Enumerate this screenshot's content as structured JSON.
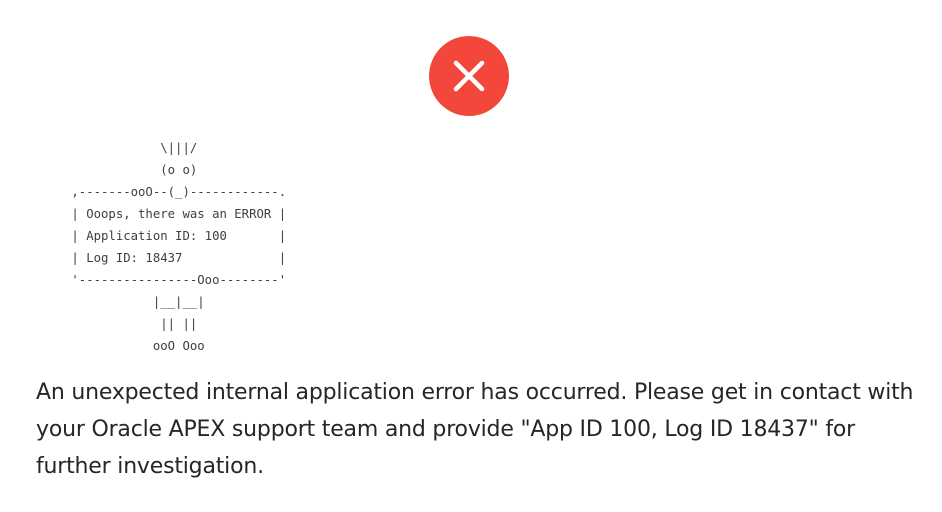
{
  "error_icon": {
    "icon": "close-icon",
    "color": "#f2473a"
  },
  "ascii_art": "             \\|||/\n             (o o)\n ,-------ooO--(_)------------.\n | Ooops, there was an ERROR |\n | Application ID: 100       |\n | Log ID: 18437             |\n '----------------Ooo--------'\n            |__|__|\n             || ||\n            ooO Ooo",
  "message": "An unexpected internal application error has occurred. Please get in contact with your Oracle APEX support team and provide \"App ID 100, Log ID 18437\" for further investigation."
}
